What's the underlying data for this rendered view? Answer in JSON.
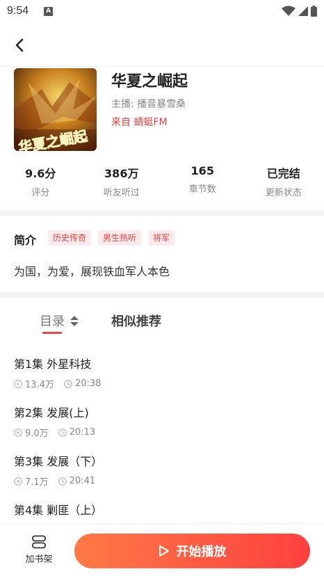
{
  "status_bar": {
    "time": "9:54",
    "notification_badge": "A"
  },
  "book": {
    "title": "华夏之崛起",
    "anchor": "主播: 播音暴雪桑",
    "source": "来自 蜻蜓FM",
    "cover_text": "华夏之崛起"
  },
  "stats": [
    {
      "value": "9.6分",
      "label": "评分"
    },
    {
      "value": "386万",
      "label": "听友听过"
    },
    {
      "value": "165",
      "label": "章节数"
    },
    {
      "value": "已完结",
      "label": "更新状态"
    }
  ],
  "intro": {
    "title": "简介",
    "tags": [
      "历史传奇",
      "男生热听",
      "将军"
    ],
    "text": "为国，为爱，展现铁血军人本色"
  },
  "tabs": {
    "catalog": "目录",
    "similar": "相似推荐"
  },
  "episodes": [
    {
      "title": "第1集 外星科技",
      "plays": "13.4万",
      "duration": "20:38"
    },
    {
      "title": "第2集 发展(上)",
      "plays": "9.0万",
      "duration": "20:13"
    },
    {
      "title": "第3集 发展（下）",
      "plays": "7.1万",
      "duration": "20:41"
    },
    {
      "title": "第4集 剿匪（上）",
      "plays": "",
      "duration": ""
    }
  ],
  "bottom": {
    "shelf_label": "加书架",
    "play_label": "开始播放"
  },
  "colors": {
    "accent": "#e84040",
    "play_gradient_start": "#ff7a45",
    "play_gradient_end": "#ff4040"
  }
}
